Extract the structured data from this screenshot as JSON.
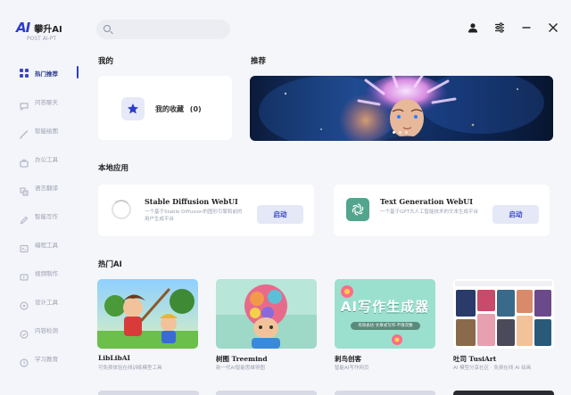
{
  "brand": {
    "logo": "AI",
    "name": "攀升AI",
    "version": "POST AI-PT"
  },
  "sidebar": {
    "items": [
      {
        "label": "热门推荐",
        "active": true
      },
      {
        "label": "问答聊天"
      },
      {
        "label": "智能绘图"
      },
      {
        "label": "办公工具"
      },
      {
        "label": "语言翻译"
      },
      {
        "label": "智能写作"
      },
      {
        "label": "编程工具"
      },
      {
        "label": "视频制作"
      },
      {
        "label": "设计工具"
      },
      {
        "label": "内容检测"
      },
      {
        "label": "学习教育"
      }
    ]
  },
  "search": {
    "placeholder": "",
    "value": ""
  },
  "topbar": {
    "icons": [
      "user-icon",
      "settings-icon",
      "minimize-icon",
      "close-icon"
    ]
  },
  "sections": {
    "mine": "我的",
    "recommended": "推荐",
    "local_apps": "本地应用",
    "hot_ai": "热门AI"
  },
  "favorites": {
    "label": "我的收藏",
    "count": "(0)"
  },
  "banner": {
    "slides": 3,
    "active_slide": 1
  },
  "local_apps": [
    {
      "name": "Stable Diffusion WebUI",
      "desc": "一个基于Stable Diffusion的图形引擎和前的用户生成平台",
      "button": "启动"
    },
    {
      "name": "Text Generation WebUI",
      "desc": "一个基于GPT大人工智能技术的文本生成平台",
      "button": "启动"
    }
  ],
  "hot_ai": [
    {
      "name": "LibLibAI",
      "desc": "可免费体验在线训练模型工具"
    },
    {
      "name": "树图 Treemind",
      "desc": "新一代AI智能思维导图"
    },
    {
      "name": "刺鸟创客",
      "desc": "智能AI写作网页"
    },
    {
      "name": "吐司 TusiArt",
      "desc": "AI 模型分享社区 · 免费在线 AI 绘画"
    }
  ],
  "poster": {
    "title": "AI写作生成器",
    "subtitle": "有效表达·文章式写作·不限次数"
  },
  "colors": {
    "accent": "#2b3cc9",
    "button_bg": "#e4e8f7",
    "sidebar_bg": "#f4f5fa"
  }
}
